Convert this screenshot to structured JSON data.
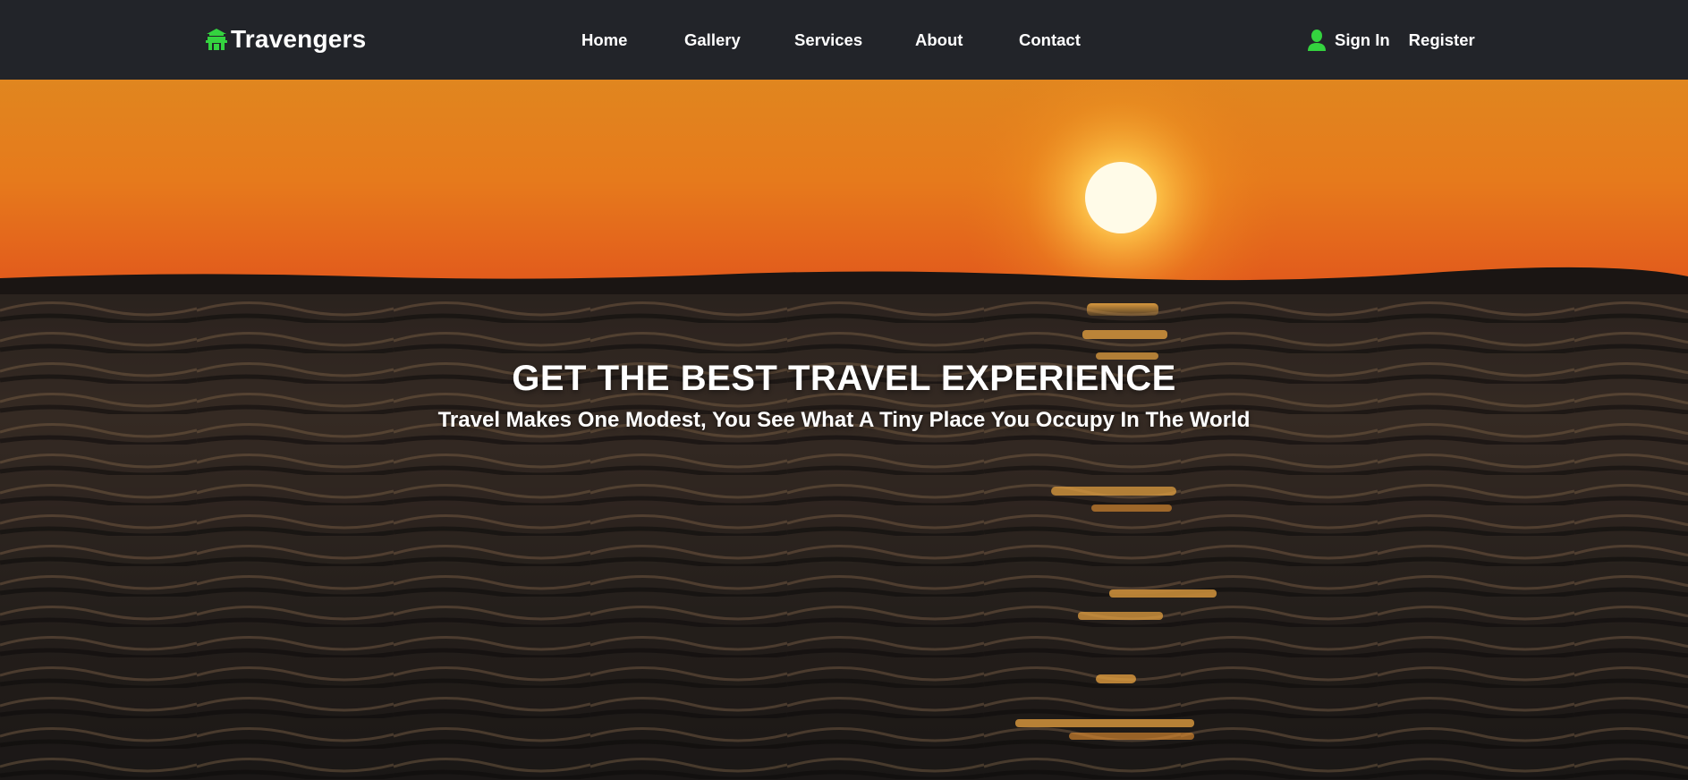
{
  "brand": {
    "name": "Travengers",
    "icon": "pagoda-icon",
    "accent_color": "#34d33f"
  },
  "nav": {
    "items": [
      {
        "label": "Home"
      },
      {
        "label": "Gallery"
      },
      {
        "label": "Services"
      },
      {
        "label": "About"
      },
      {
        "label": "Contact"
      }
    ]
  },
  "auth": {
    "signin_label": "Sign In",
    "signin_icon": "user-icon",
    "register_label": "Register"
  },
  "hero": {
    "title": "GET THE BEST TRAVEL EXPERIENCE",
    "subtitle": "Travel Makes One Modest, You See What A Tiny Place You Occupy In The World"
  },
  "colors": {
    "navbar_bg": "#222429",
    "text": "#ffffff"
  }
}
